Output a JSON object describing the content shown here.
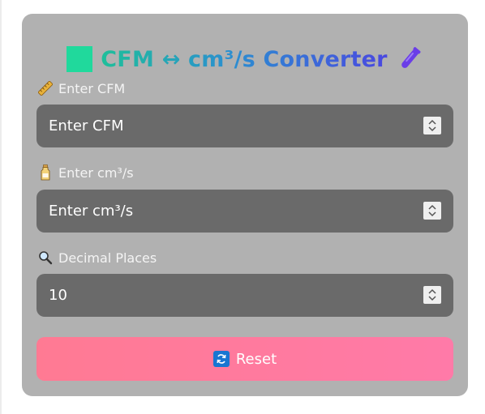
{
  "title": {
    "text": "CFM ↔ cm³/s Converter",
    "left_icon": "green-square-icon",
    "right_icon": "test-tube-icon"
  },
  "fields": [
    {
      "label": "Enter CFM",
      "label_icon": "ruler-icon",
      "placeholder": "Enter CFM",
      "value": ""
    },
    {
      "label": "Enter cm³/s",
      "label_icon": "bottle-icon",
      "placeholder": "Enter cm³/s",
      "value": ""
    },
    {
      "label": "Decimal Places",
      "label_icon": "magnifier-icon",
      "placeholder": "",
      "value": "10"
    }
  ],
  "reset": {
    "label": "Reset",
    "icon": "refresh-icon"
  },
  "colors": {
    "card_bg": "#b1b1b1",
    "input_bg": "#6a6a6a",
    "reset_start": "#ff7a93",
    "reset_end": "#ff7aa8",
    "title_square": "#20d99c",
    "tube": "#6a3de8"
  }
}
